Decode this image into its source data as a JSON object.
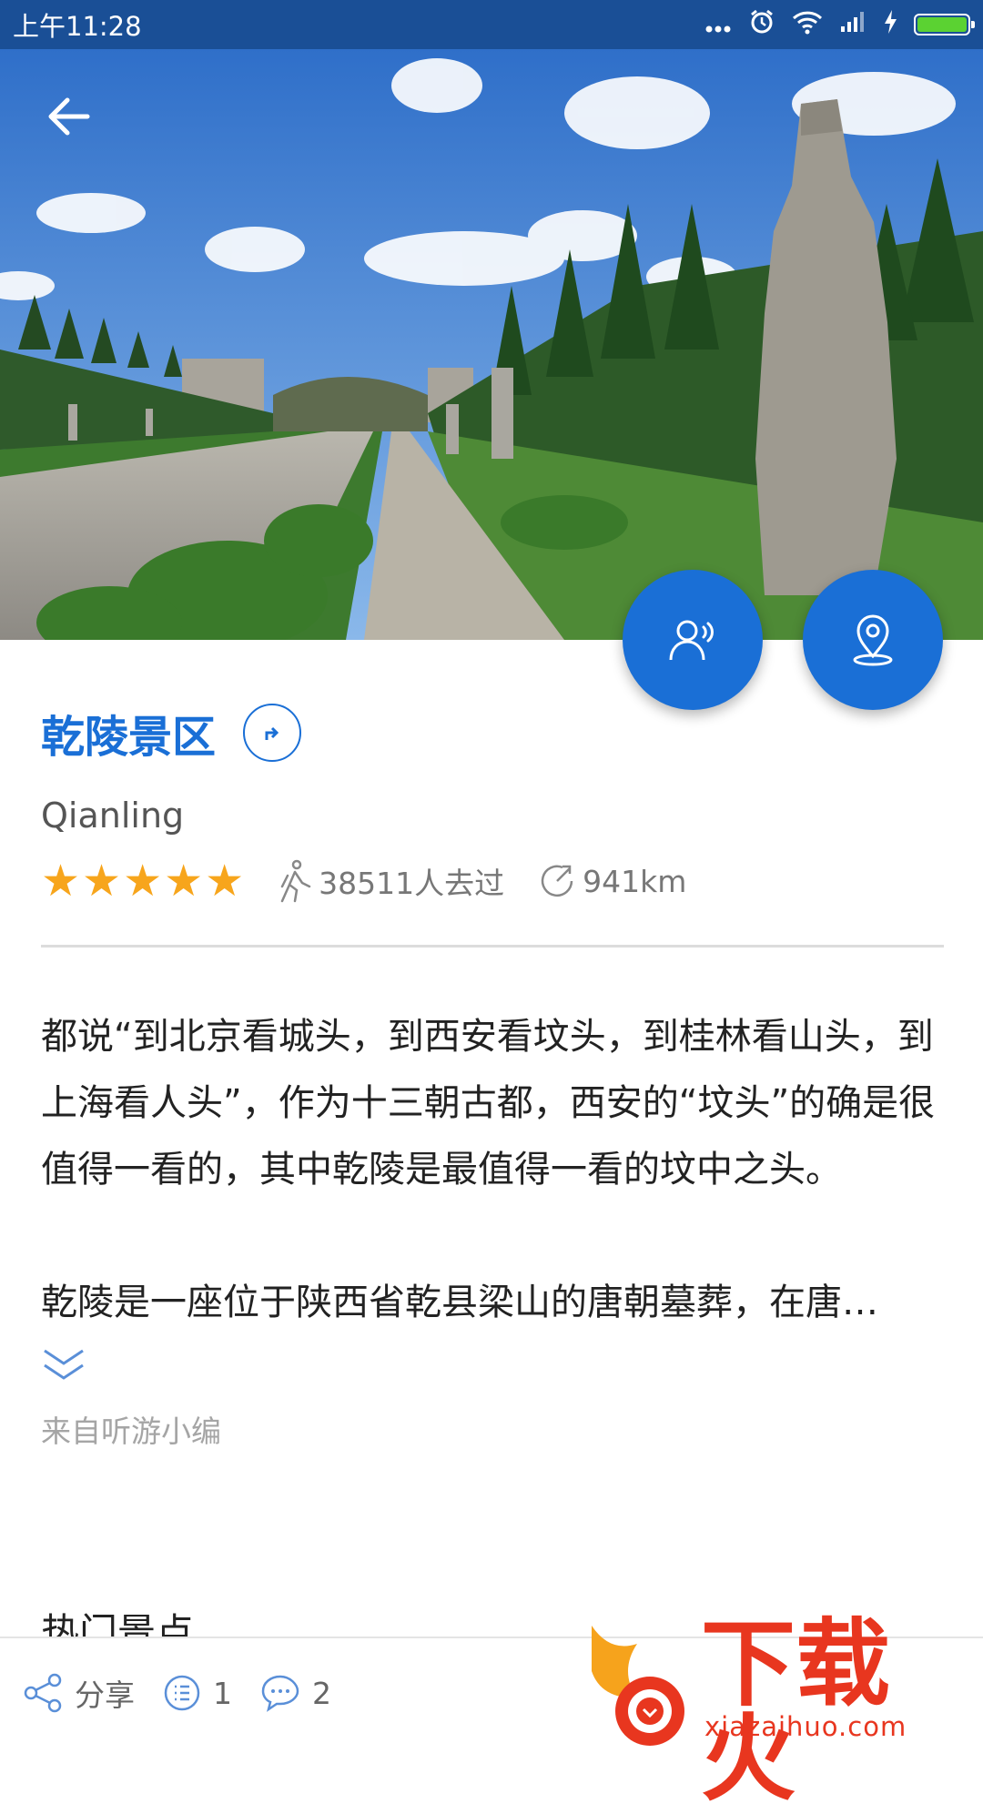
{
  "status_bar": {
    "time": "上午11:28",
    "icons": [
      "more-dots-icon",
      "alarm-icon",
      "wifi-icon",
      "signal-icon",
      "charging-icon",
      "battery-icon"
    ],
    "battery_level": 1.0
  },
  "hero": {
    "icons": {
      "back": "back-arrow-icon",
      "audio": "audio-guide-icon",
      "map": "map-location-icon"
    }
  },
  "attraction": {
    "title": "乾陵景区",
    "subtitle": "Qianling",
    "rating": 5,
    "rating_max": 5,
    "visitors": "38511人去过",
    "distance": "941km"
  },
  "description": {
    "p1": "都说“到北京看城头，到西安看坟头，到桂林看山头，到上海看人头”，作为十三朝古都，西安的“坟头”的确是很值得一看的，其中乾陵是最值得一看的坟中之头。",
    "p2": "乾陵是一座位于陕西省乾县梁山的唐朝墓葬，在唐…",
    "source": "来自听游小编"
  },
  "section": {
    "hot_spots": "热门景点"
  },
  "bottom_bar": {
    "share_label": "分享",
    "list_count": "1",
    "comment_count": "2"
  },
  "watermark": {
    "brand": "下载火",
    "url": "xiazaihuo.com"
  },
  "colors": {
    "accent": "#1a6fd6",
    "status_bar": "#1a4f96",
    "star": "#f7a51c",
    "watermark": "#e8361f"
  }
}
